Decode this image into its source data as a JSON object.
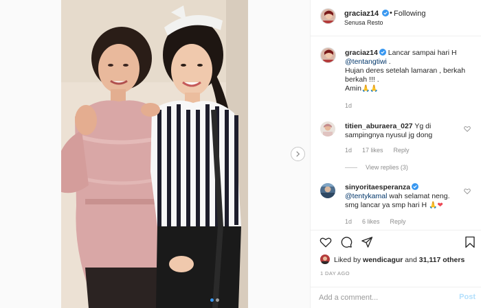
{
  "header": {
    "username": "graciaz14",
    "separator": "•",
    "follow_status": "Following",
    "location": "Senusa Resto"
  },
  "caption": {
    "username": "graciaz14",
    "text_before": "Lancar sampai hari H",
    "mention": "@tentangtiwi",
    "text_after": " .",
    "line2": "Hujan deres setelah lamaran , berkah berkah !!! .",
    "line3": "Amin",
    "emoji": "🙏🙏",
    "time": "1d"
  },
  "comments": [
    {
      "username": "titien_aburaera_027",
      "text": "Yg di sampingnya nyusul jg dong",
      "time": "1d",
      "likes": "17 likes",
      "reply": "Reply",
      "view_replies": "View replies (3)"
    },
    {
      "username": "sinyoritaesperanza",
      "mention": "@tentykamal",
      "text": " wah selamat neng. smg lancar ya smp hari H ",
      "emoji": "🙏",
      "emoji_heart": "❤",
      "time": "1d",
      "likes": "6 likes",
      "reply": "Reply"
    }
  ],
  "likes": {
    "prefix": "Liked by ",
    "user": "wendicagur",
    "middle": " and ",
    "count": "31,117 others"
  },
  "post_time": "1 DAY AGO",
  "add_comment": {
    "placeholder": "Add a comment...",
    "post_label": "Post"
  },
  "colors": {
    "verified": "#3897f0",
    "mention": "#003569",
    "muted": "#8e8e8e",
    "post_disabled": "#b2dffc"
  },
  "carousel": {
    "total": 2,
    "current": 1
  }
}
